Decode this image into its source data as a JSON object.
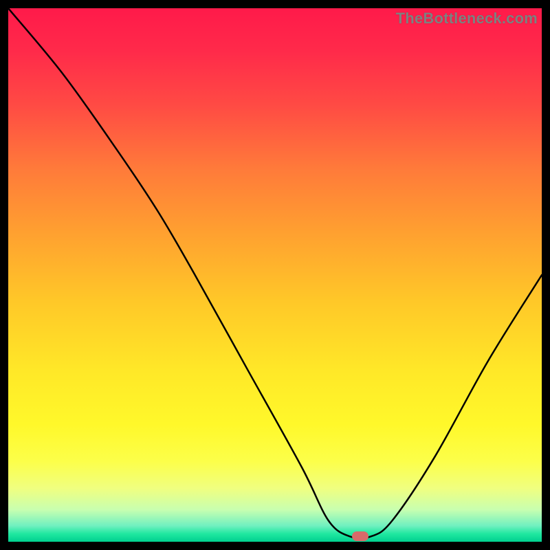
{
  "watermark": "TheBottleneck.com",
  "chart_data": {
    "type": "line",
    "title": "",
    "xlabel": "",
    "ylabel": "",
    "xlim": [
      0,
      100
    ],
    "ylim": [
      0,
      100
    ],
    "background_gradient": {
      "top": "#ff1a4a",
      "upper_mid": "#ffa030",
      "mid": "#ffe828",
      "lower": "#c8ffb0",
      "bottom": "#00d090"
    },
    "curve": [
      {
        "x": 0,
        "y": 100
      },
      {
        "x": 10,
        "y": 88
      },
      {
        "x": 20,
        "y": 74
      },
      {
        "x": 28,
        "y": 62
      },
      {
        "x": 35,
        "y": 50
      },
      {
        "x": 45,
        "y": 32
      },
      {
        "x": 55,
        "y": 14
      },
      {
        "x": 60,
        "y": 4
      },
      {
        "x": 64,
        "y": 1
      },
      {
        "x": 68,
        "y": 1
      },
      {
        "x": 72,
        "y": 4
      },
      {
        "x": 80,
        "y": 16
      },
      {
        "x": 90,
        "y": 34
      },
      {
        "x": 100,
        "y": 50
      }
    ],
    "marker": {
      "x": 66,
      "y": 1,
      "color": "#d86a6a"
    },
    "annotations": []
  }
}
